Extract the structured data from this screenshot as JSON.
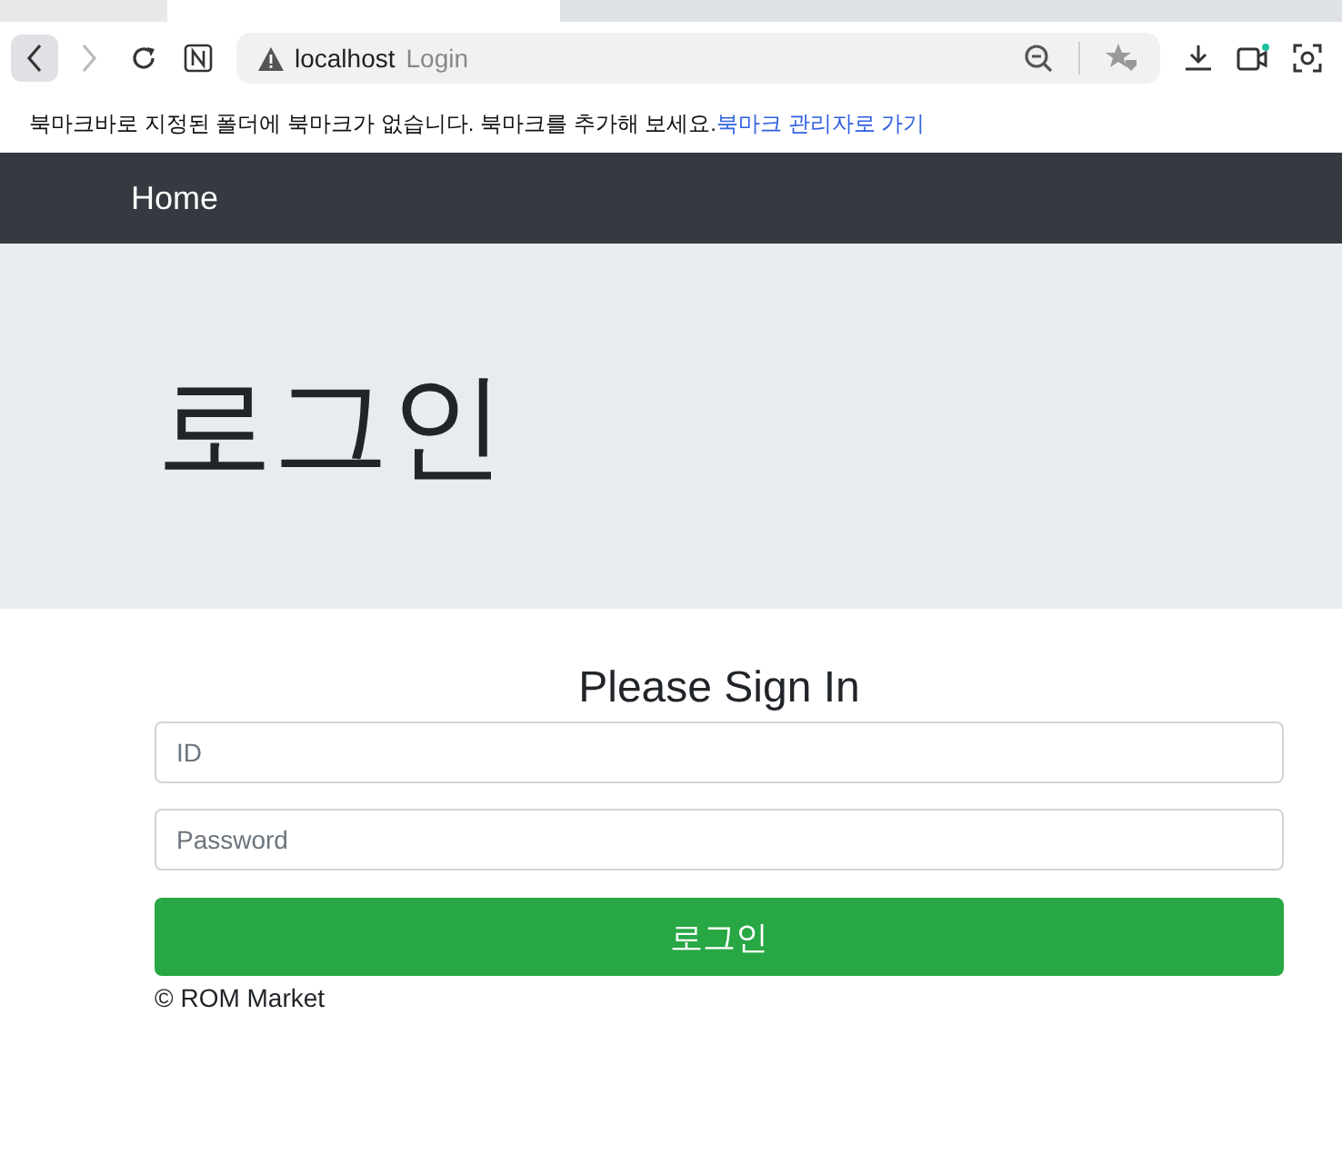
{
  "browser": {
    "address_host": "localhost",
    "address_title": "Login",
    "bookmark_message": "북마크바로 지정된 폴더에 북마크가 없습니다. 북마크를 추가해 보세요.",
    "bookmark_link": "북마크 관리자로 가기"
  },
  "navbar": {
    "brand": "Home"
  },
  "jumbotron": {
    "heading": "로그인"
  },
  "form": {
    "title": "Please Sign In",
    "fields": [
      {
        "placeholder": "ID"
      },
      {
        "placeholder": "Password"
      }
    ],
    "submit": "로그인"
  },
  "footer": "© ROM Market"
}
